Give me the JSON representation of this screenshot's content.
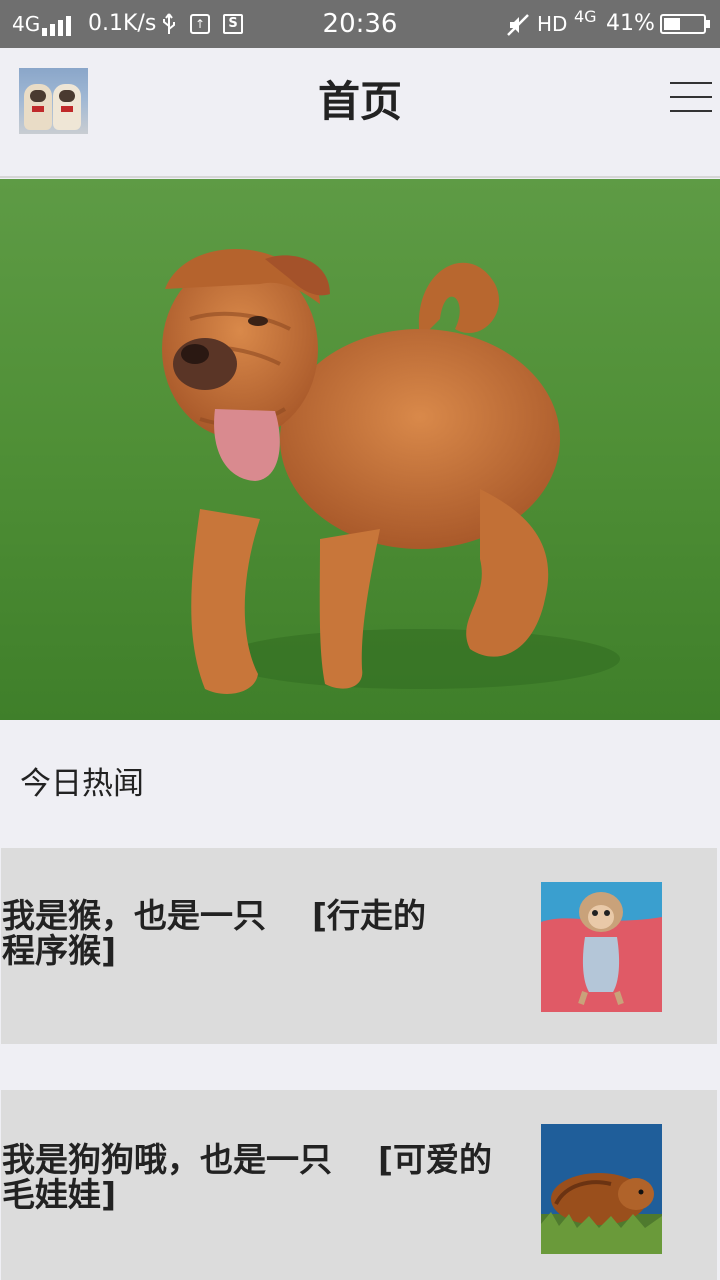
{
  "status_bar": {
    "network": "4G",
    "speed": "0.1K/s",
    "box_icon_text": "S",
    "time": "20:36",
    "hd": "HD",
    "net2": "4G",
    "battery_percent": "41%",
    "battery_level": 0.41,
    "icons": [
      "signal-icon",
      "usb-icon",
      "app-notification-icon",
      "s-notification-icon",
      "mute-icon",
      "battery-icon"
    ]
  },
  "header": {
    "title": "首页",
    "avatar": "avatar-pugs-icon",
    "menu_icon": "hamburger-menu-icon"
  },
  "hero": {
    "image": "shar-pei-dog-on-grass"
  },
  "section": {
    "title": "今日热闻"
  },
  "news": [
    {
      "text": "我是猴，也是一只    [行走的\n程序猴]",
      "thumbnail": "monkey-thumbnail"
    },
    {
      "text": "我是狗狗哦，也是一只    [可爱的\n毛娃娃]",
      "thumbnail": "guinea-pig-thumbnail"
    }
  ],
  "colors": {
    "status_bar_bg": "#6f6f6f",
    "page_bg": "#efeff4",
    "news_item_bg": "#dcdcdc",
    "text": "#222222"
  }
}
